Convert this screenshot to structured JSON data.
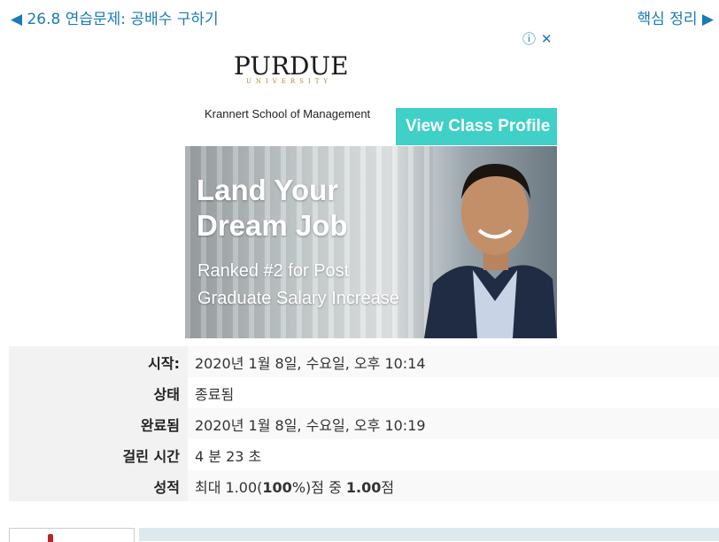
{
  "nav": {
    "prev_label": "◀ 26.8 연습문제: 공배수 구하기",
    "next_label": "핵심 정리 ▶"
  },
  "ad_controls": {
    "info_icon": "info-circle-icon",
    "close_icon": "close-icon"
  },
  "ad": {
    "brand": "PURDUE",
    "brand_sub": "UNIVERSITY",
    "school": "Krannert School of Management",
    "cta": "View Class Profile ›",
    "headline": "Land Your Dream Job",
    "subline": "Ranked #2 for Post Graduate Salary Increase",
    "accent_color": "#3fd0c7"
  },
  "summary": [
    {
      "label": "시작:",
      "value": "2020년 1월 8일, 수요일, 오후 10:14"
    },
    {
      "label": "상태",
      "value": "종료됨"
    },
    {
      "label": "완료됨",
      "value": "2020년 1월 8일, 수요일, 오후 10:19"
    },
    {
      "label": "걸린 시간",
      "value": "4 분 23 초"
    },
    {
      "label": "성적",
      "value_prefix": "최대 1.00(",
      "value_bold_1": "100",
      "value_mid": "%)점 중 ",
      "value_bold_2": "1.00",
      "value_suffix": "점"
    }
  ]
}
